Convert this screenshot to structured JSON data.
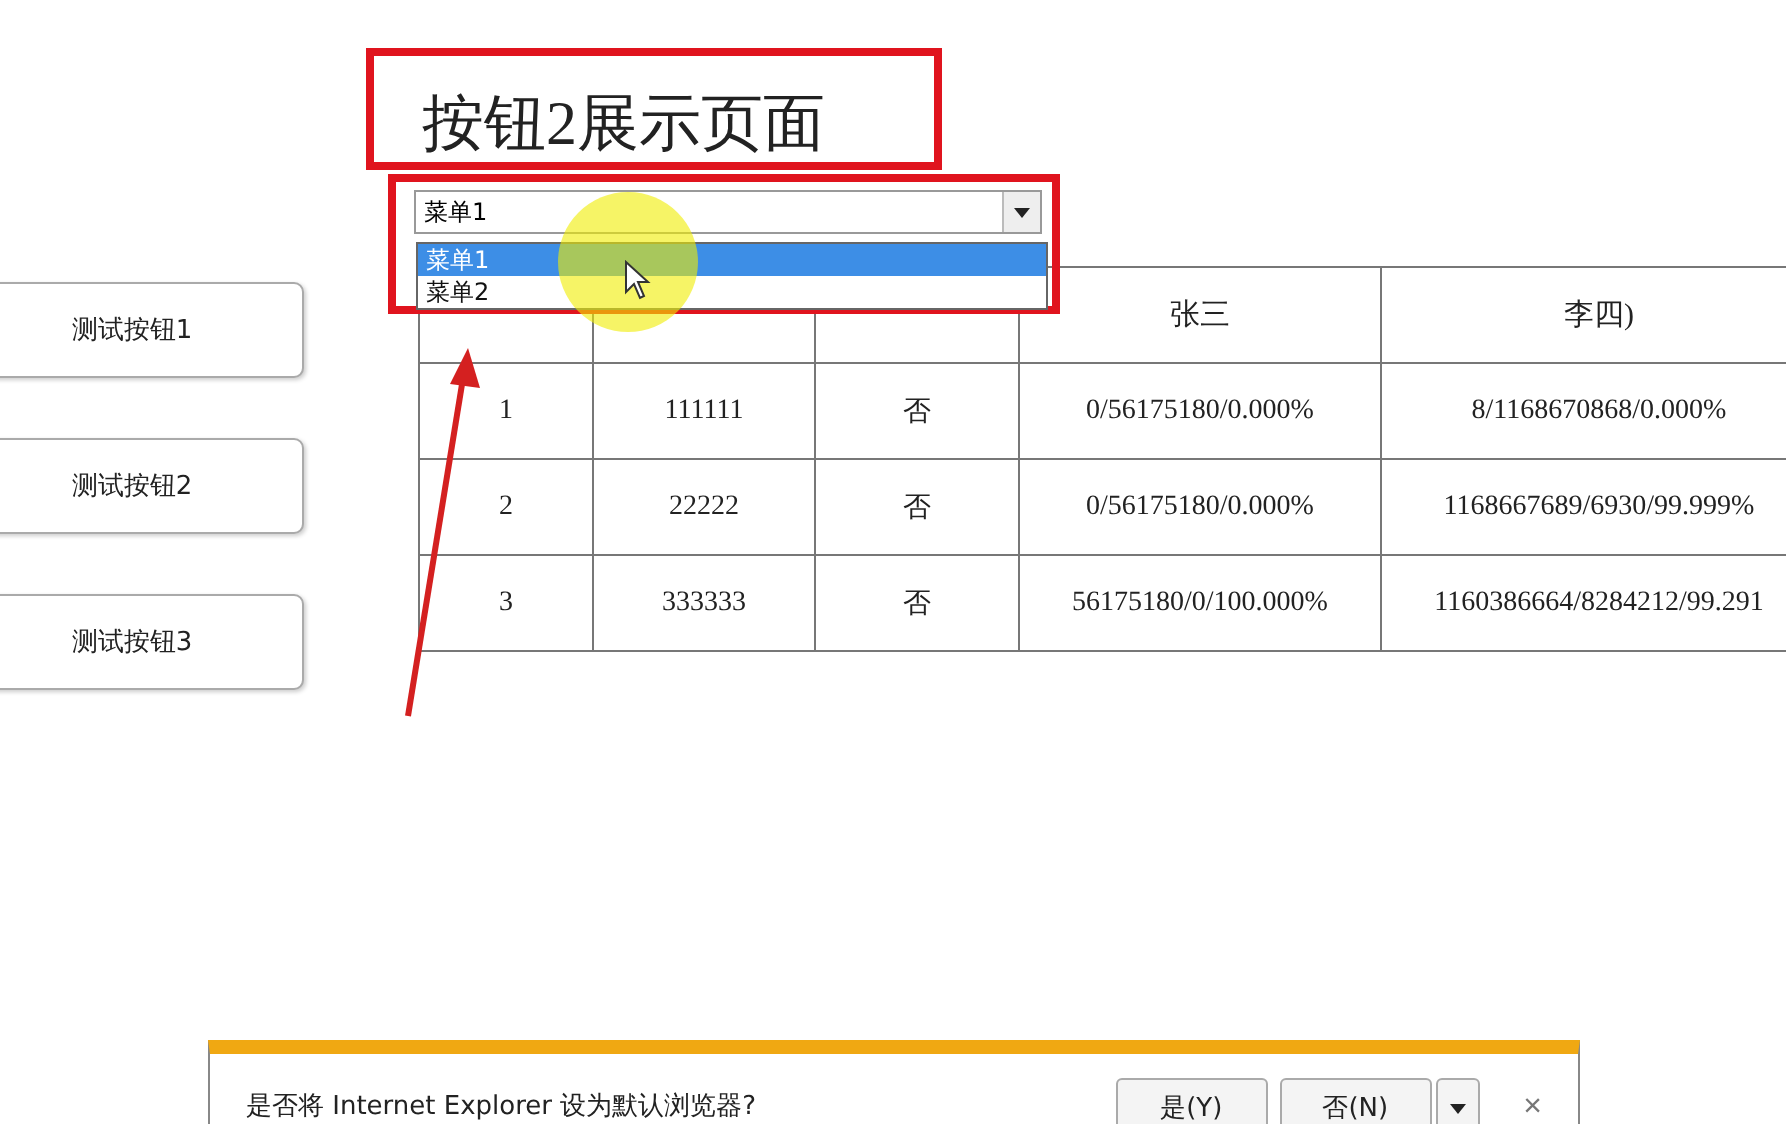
{
  "page_title": "按钮2展示页面",
  "side_buttons": [
    "测试按钮1",
    "测试按钮2",
    "测试按钮3"
  ],
  "select": {
    "value": "菜单1",
    "options": [
      {
        "label": "菜单1",
        "selected": true
      },
      {
        "label": "菜单2",
        "selected": false
      }
    ]
  },
  "table": {
    "columns": [
      "",
      "",
      "",
      "张三",
      "李四)"
    ],
    "rows": [
      [
        "1",
        "111111",
        "否",
        "0/56175180/0.000%",
        "8/1168670868/0.000%"
      ],
      [
        "2",
        "22222",
        "否",
        "0/56175180/0.000%",
        "1168667689/6930/99.999%"
      ],
      [
        "3",
        "333333",
        "否",
        "56175180/0/100.000%",
        "1160386664/8284212/99.291"
      ]
    ]
  },
  "notification": {
    "message": "是否将 Internet Explorer 设为默认浏览器?",
    "buttons": [
      "是(Y)",
      "否(N)"
    ],
    "close": "×"
  }
}
